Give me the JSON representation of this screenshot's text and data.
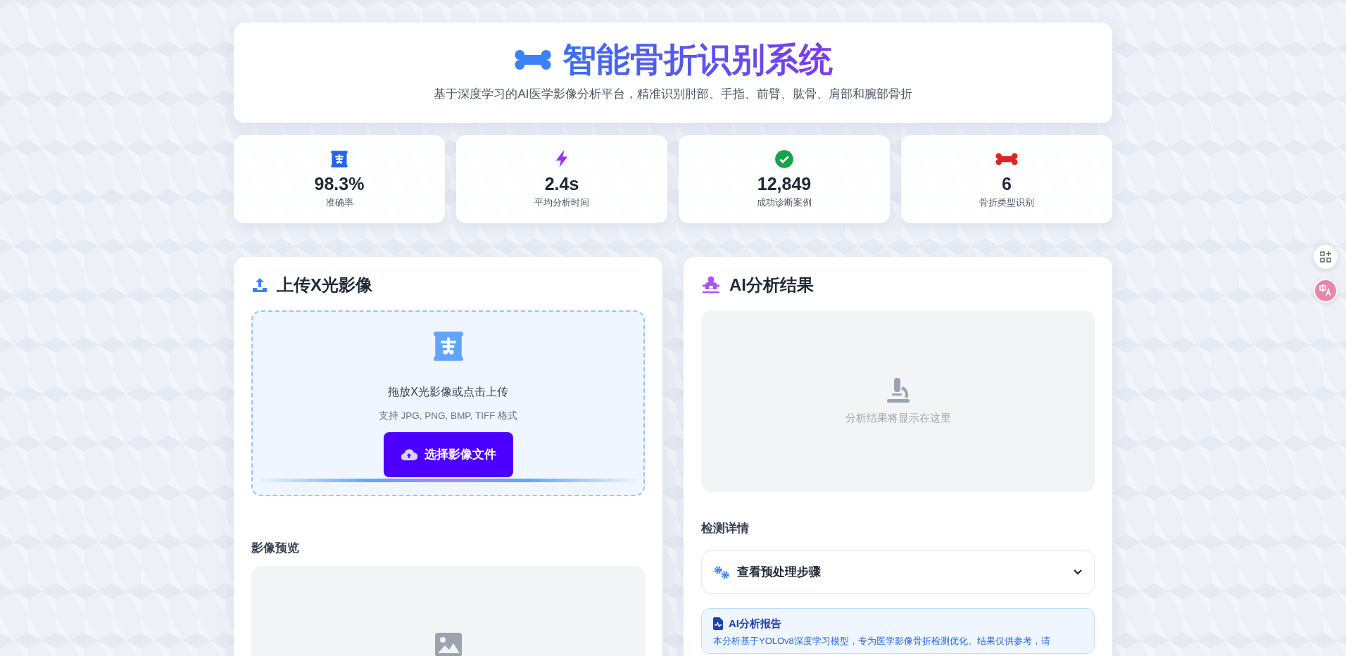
{
  "header": {
    "title": "智能骨折识别系统",
    "subtitle": "基于深度学习的AI医学影像分析平台，精准识别肘部、手指、前臂、肱骨、肩部和腕部骨折"
  },
  "stats": [
    {
      "kind": "xray",
      "value": "98.3%",
      "label": "准确率"
    },
    {
      "kind": "bolt",
      "value": "2.4s",
      "label": "平均分析时间"
    },
    {
      "kind": "check",
      "value": "12,849",
      "label": "成功诊断案例"
    },
    {
      "kind": "bone",
      "value": "6",
      "label": "骨折类型识别"
    }
  ],
  "upload_panel": {
    "title": "上传X光影像",
    "dropzone": {
      "prompt": "拖放X光影像或点击上传",
      "formats": "支持 JPG, PNG, BMP, TIFF 格式",
      "button": "选择影像文件"
    },
    "preview_title": "影像预览"
  },
  "result_panel": {
    "title": "AI分析结果",
    "placeholder": "分析结果将显示在这里",
    "details_title": "检测详情",
    "accordion": {
      "label": "查看预处理步骤",
      "expanded": false
    },
    "report": {
      "title": "AI分析报告",
      "text": "本分析基于YOLOv8深度学习模型，专为医学影像骨折检测优化。结果仅供参考，请"
    }
  }
}
